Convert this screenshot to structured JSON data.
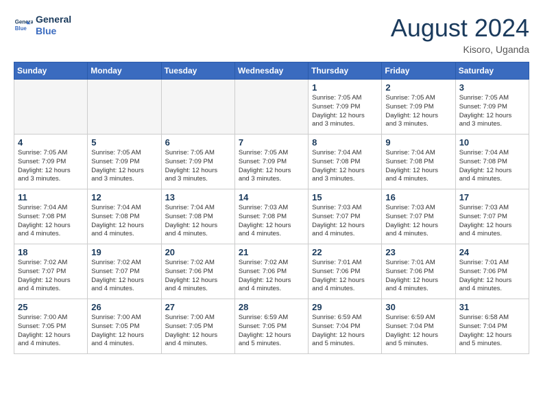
{
  "header": {
    "logo_line1": "General",
    "logo_line2": "Blue",
    "month_year": "August 2024",
    "location": "Kisoro, Uganda"
  },
  "days_of_week": [
    "Sunday",
    "Monday",
    "Tuesday",
    "Wednesday",
    "Thursday",
    "Friday",
    "Saturday"
  ],
  "weeks": [
    [
      {
        "day": "",
        "info": "",
        "empty": true
      },
      {
        "day": "",
        "info": "",
        "empty": true
      },
      {
        "day": "",
        "info": "",
        "empty": true
      },
      {
        "day": "",
        "info": "",
        "empty": true
      },
      {
        "day": "1",
        "info": "Sunrise: 7:05 AM\nSunset: 7:09 PM\nDaylight: 12 hours\nand 3 minutes."
      },
      {
        "day": "2",
        "info": "Sunrise: 7:05 AM\nSunset: 7:09 PM\nDaylight: 12 hours\nand 3 minutes."
      },
      {
        "day": "3",
        "info": "Sunrise: 7:05 AM\nSunset: 7:09 PM\nDaylight: 12 hours\nand 3 minutes."
      }
    ],
    [
      {
        "day": "4",
        "info": "Sunrise: 7:05 AM\nSunset: 7:09 PM\nDaylight: 12 hours\nand 3 minutes."
      },
      {
        "day": "5",
        "info": "Sunrise: 7:05 AM\nSunset: 7:09 PM\nDaylight: 12 hours\nand 3 minutes."
      },
      {
        "day": "6",
        "info": "Sunrise: 7:05 AM\nSunset: 7:09 PM\nDaylight: 12 hours\nand 3 minutes."
      },
      {
        "day": "7",
        "info": "Sunrise: 7:05 AM\nSunset: 7:09 PM\nDaylight: 12 hours\nand 3 minutes."
      },
      {
        "day": "8",
        "info": "Sunrise: 7:04 AM\nSunset: 7:08 PM\nDaylight: 12 hours\nand 3 minutes."
      },
      {
        "day": "9",
        "info": "Sunrise: 7:04 AM\nSunset: 7:08 PM\nDaylight: 12 hours\nand 4 minutes."
      },
      {
        "day": "10",
        "info": "Sunrise: 7:04 AM\nSunset: 7:08 PM\nDaylight: 12 hours\nand 4 minutes."
      }
    ],
    [
      {
        "day": "11",
        "info": "Sunrise: 7:04 AM\nSunset: 7:08 PM\nDaylight: 12 hours\nand 4 minutes."
      },
      {
        "day": "12",
        "info": "Sunrise: 7:04 AM\nSunset: 7:08 PM\nDaylight: 12 hours\nand 4 minutes."
      },
      {
        "day": "13",
        "info": "Sunrise: 7:04 AM\nSunset: 7:08 PM\nDaylight: 12 hours\nand 4 minutes."
      },
      {
        "day": "14",
        "info": "Sunrise: 7:03 AM\nSunset: 7:08 PM\nDaylight: 12 hours\nand 4 minutes."
      },
      {
        "day": "15",
        "info": "Sunrise: 7:03 AM\nSunset: 7:07 PM\nDaylight: 12 hours\nand 4 minutes."
      },
      {
        "day": "16",
        "info": "Sunrise: 7:03 AM\nSunset: 7:07 PM\nDaylight: 12 hours\nand 4 minutes."
      },
      {
        "day": "17",
        "info": "Sunrise: 7:03 AM\nSunset: 7:07 PM\nDaylight: 12 hours\nand 4 minutes."
      }
    ],
    [
      {
        "day": "18",
        "info": "Sunrise: 7:02 AM\nSunset: 7:07 PM\nDaylight: 12 hours\nand 4 minutes."
      },
      {
        "day": "19",
        "info": "Sunrise: 7:02 AM\nSunset: 7:07 PM\nDaylight: 12 hours\nand 4 minutes."
      },
      {
        "day": "20",
        "info": "Sunrise: 7:02 AM\nSunset: 7:06 PM\nDaylight: 12 hours\nand 4 minutes."
      },
      {
        "day": "21",
        "info": "Sunrise: 7:02 AM\nSunset: 7:06 PM\nDaylight: 12 hours\nand 4 minutes."
      },
      {
        "day": "22",
        "info": "Sunrise: 7:01 AM\nSunset: 7:06 PM\nDaylight: 12 hours\nand 4 minutes."
      },
      {
        "day": "23",
        "info": "Sunrise: 7:01 AM\nSunset: 7:06 PM\nDaylight: 12 hours\nand 4 minutes."
      },
      {
        "day": "24",
        "info": "Sunrise: 7:01 AM\nSunset: 7:06 PM\nDaylight: 12 hours\nand 4 minutes."
      }
    ],
    [
      {
        "day": "25",
        "info": "Sunrise: 7:00 AM\nSunset: 7:05 PM\nDaylight: 12 hours\nand 4 minutes."
      },
      {
        "day": "26",
        "info": "Sunrise: 7:00 AM\nSunset: 7:05 PM\nDaylight: 12 hours\nand 4 minutes."
      },
      {
        "day": "27",
        "info": "Sunrise: 7:00 AM\nSunset: 7:05 PM\nDaylight: 12 hours\nand 4 minutes."
      },
      {
        "day": "28",
        "info": "Sunrise: 6:59 AM\nSunset: 7:05 PM\nDaylight: 12 hours\nand 5 minutes."
      },
      {
        "day": "29",
        "info": "Sunrise: 6:59 AM\nSunset: 7:04 PM\nDaylight: 12 hours\nand 5 minutes."
      },
      {
        "day": "30",
        "info": "Sunrise: 6:59 AM\nSunset: 7:04 PM\nDaylight: 12 hours\nand 5 minutes."
      },
      {
        "day": "31",
        "info": "Sunrise: 6:58 AM\nSunset: 7:04 PM\nDaylight: 12 hours\nand 5 minutes."
      }
    ]
  ]
}
